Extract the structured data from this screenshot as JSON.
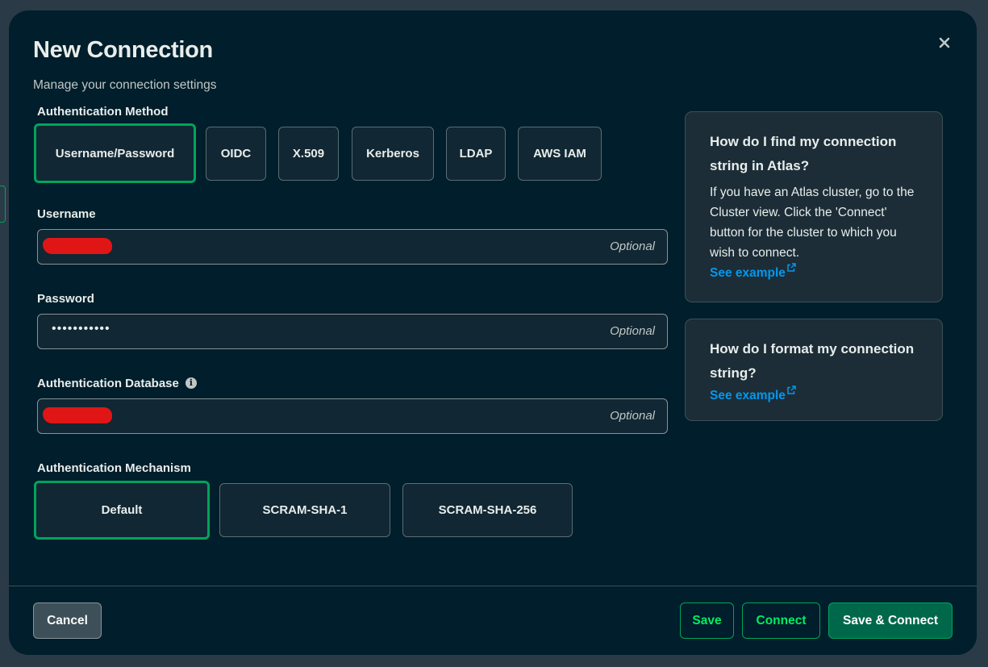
{
  "modal": {
    "title": "New Connection",
    "subtitle": "Manage your connection settings"
  },
  "auth_method": {
    "label": "Authentication Method",
    "options": [
      "Username/Password",
      "OIDC",
      "X.509",
      "Kerberos",
      "LDAP",
      "AWS IAM"
    ],
    "selected": "Username/Password"
  },
  "username": {
    "label": "Username",
    "placeholder": "Optional",
    "value_redacted": true
  },
  "password": {
    "label": "Password",
    "placeholder": "Optional",
    "masked_value": "•••••••••••"
  },
  "auth_database": {
    "label": "Authentication Database",
    "placeholder": "Optional",
    "value_redacted": true,
    "info_icon": "info-icon"
  },
  "auth_mechanism": {
    "label": "Authentication Mechanism",
    "options": [
      "Default",
      "SCRAM-SHA-1",
      "SCRAM-SHA-256"
    ],
    "selected": "Default"
  },
  "help_cards": [
    {
      "title": "How do I find my connection string in Atlas?",
      "body": "If you have an Atlas cluster, go to the Cluster view. Click the 'Connect' button for the cluster to which you wish to connect.",
      "link": "See example"
    },
    {
      "title": "How do I format my connection string?",
      "link": "See example"
    }
  ],
  "footer": {
    "cancel": "Cancel",
    "save": "Save",
    "connect": "Connect",
    "save_connect": "Save & Connect"
  },
  "colors": {
    "background": "#001e2b",
    "accent": "#00a35c",
    "accent_text": "#00ed64",
    "link": "#0498ec",
    "primary_button": "#00684a",
    "redaction": "#e01616"
  }
}
